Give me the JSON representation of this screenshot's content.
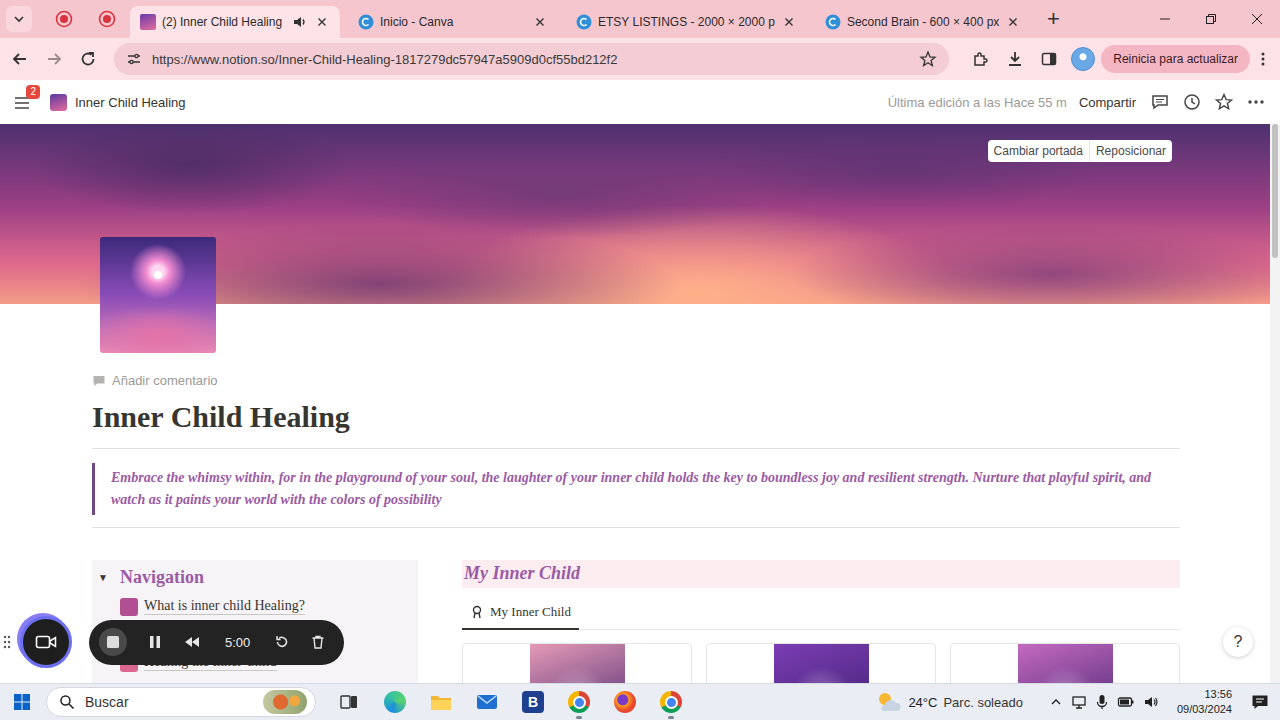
{
  "browser": {
    "pinned_tabs": [
      {
        "kind": "record"
      },
      {
        "kind": "record"
      }
    ],
    "tabs": [
      {
        "label": "(2) Inner Child Healing",
        "selected": true,
        "audio": true,
        "kind": "page"
      },
      {
        "label": "Inicio - Canva",
        "selected": false,
        "audio": false,
        "kind": "canva"
      },
      {
        "label": "ETSY LISTINGS - 2000 × 2000 p",
        "selected": false,
        "audio": false,
        "kind": "canva"
      },
      {
        "label": "Second Brain - 600 × 400 px",
        "selected": false,
        "audio": false,
        "kind": "canva"
      }
    ],
    "new_tab": "+",
    "url": "https://www.notion.so/Inner-Child-Healing-1817279dc57947a5909d0cf55bd212f2",
    "update_button": "Reinicia para actualizar"
  },
  "notion": {
    "notifications": "2",
    "breadcrumb": "Inner Child Healing",
    "last_edited": "Última edición a las Hace 55 m",
    "share": "Compartir",
    "cover_buttons": [
      "Cambiar portada",
      "Reposicionar"
    ],
    "add_comment": "Añadir comentario",
    "title": "Inner Child Healing",
    "quote": "Embrace the whimsy within, for in the playground of your soul, the laughter of your inner child holds the key to boundless joy and resilient strength. Nurture that playful spirit, and watch as it paints your world with the colors of possibility",
    "navigation": {
      "title": "Navigation",
      "toggle": "▼",
      "expanded": true,
      "items": [
        {
          "label": "What is inner child Healing?",
          "color": "#b24f92"
        },
        {
          "label": "Healing the Inner Child",
          "color": "#d9678f"
        }
      ]
    },
    "gallery": {
      "title": "My Inner Child",
      "views": [
        {
          "label": "My Inner Child",
          "selected": true
        }
      ],
      "cards": [
        {
          "color": "#e59ab6"
        },
        {
          "color": "#7b3db3"
        },
        {
          "color": "#c46ac0"
        }
      ]
    },
    "help": "?"
  },
  "recorder": {
    "time": "5:00"
  },
  "taskbar": {
    "search_placeholder": "Buscar",
    "apps": [
      {
        "kind": "task-view",
        "running": false
      },
      {
        "kind": "edge",
        "running": false
      },
      {
        "kind": "explorer",
        "running": false
      },
      {
        "kind": "mail",
        "running": false
      },
      {
        "kind": "letter",
        "glyph": "B",
        "running": false
      },
      {
        "kind": "chrome",
        "running": true
      },
      {
        "kind": "firefox",
        "running": false
      },
      {
        "kind": "chrome",
        "running": true
      }
    ],
    "weather": {
      "temp": "24°C",
      "condition": "Parc. soleado"
    },
    "time": "13:56",
    "date": "09/03/2024"
  }
}
